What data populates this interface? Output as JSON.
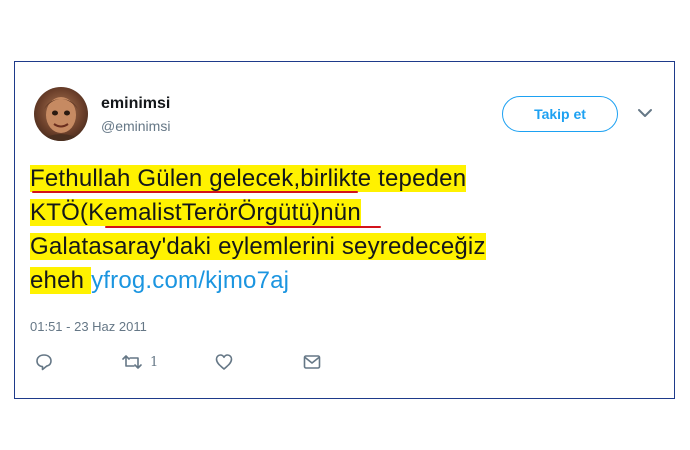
{
  "user": {
    "display_name": "eminimsi",
    "handle": "@eminimsi"
  },
  "follow_button": {
    "label": "Takip et"
  },
  "tweet": {
    "lines": [
      [
        "Fethullah Gülen gelecek",
        ",birlikte tepeden"
      ],
      [
        "KTÖ(",
        "KemalistTerörÖrgütü",
        ")nün"
      ],
      [
        "Galatasaray'daki eylemlerini seyredeceğiz"
      ],
      [
        "eheh "
      ]
    ],
    "link": "yfrog.com/kjmo7aj",
    "timestamp": "01:51 - 23 Haz 2011"
  },
  "actions": {
    "retweet_count": "1"
  },
  "colors": {
    "highlight": "#fff200",
    "underline": "#d3131b",
    "link": "#1b95e0",
    "follow_accent": "#1da1f2",
    "border": "#1e3a8a"
  },
  "icons": [
    "reply-icon",
    "retweet-icon",
    "like-icon",
    "message-icon",
    "chevron-down-icon"
  ]
}
